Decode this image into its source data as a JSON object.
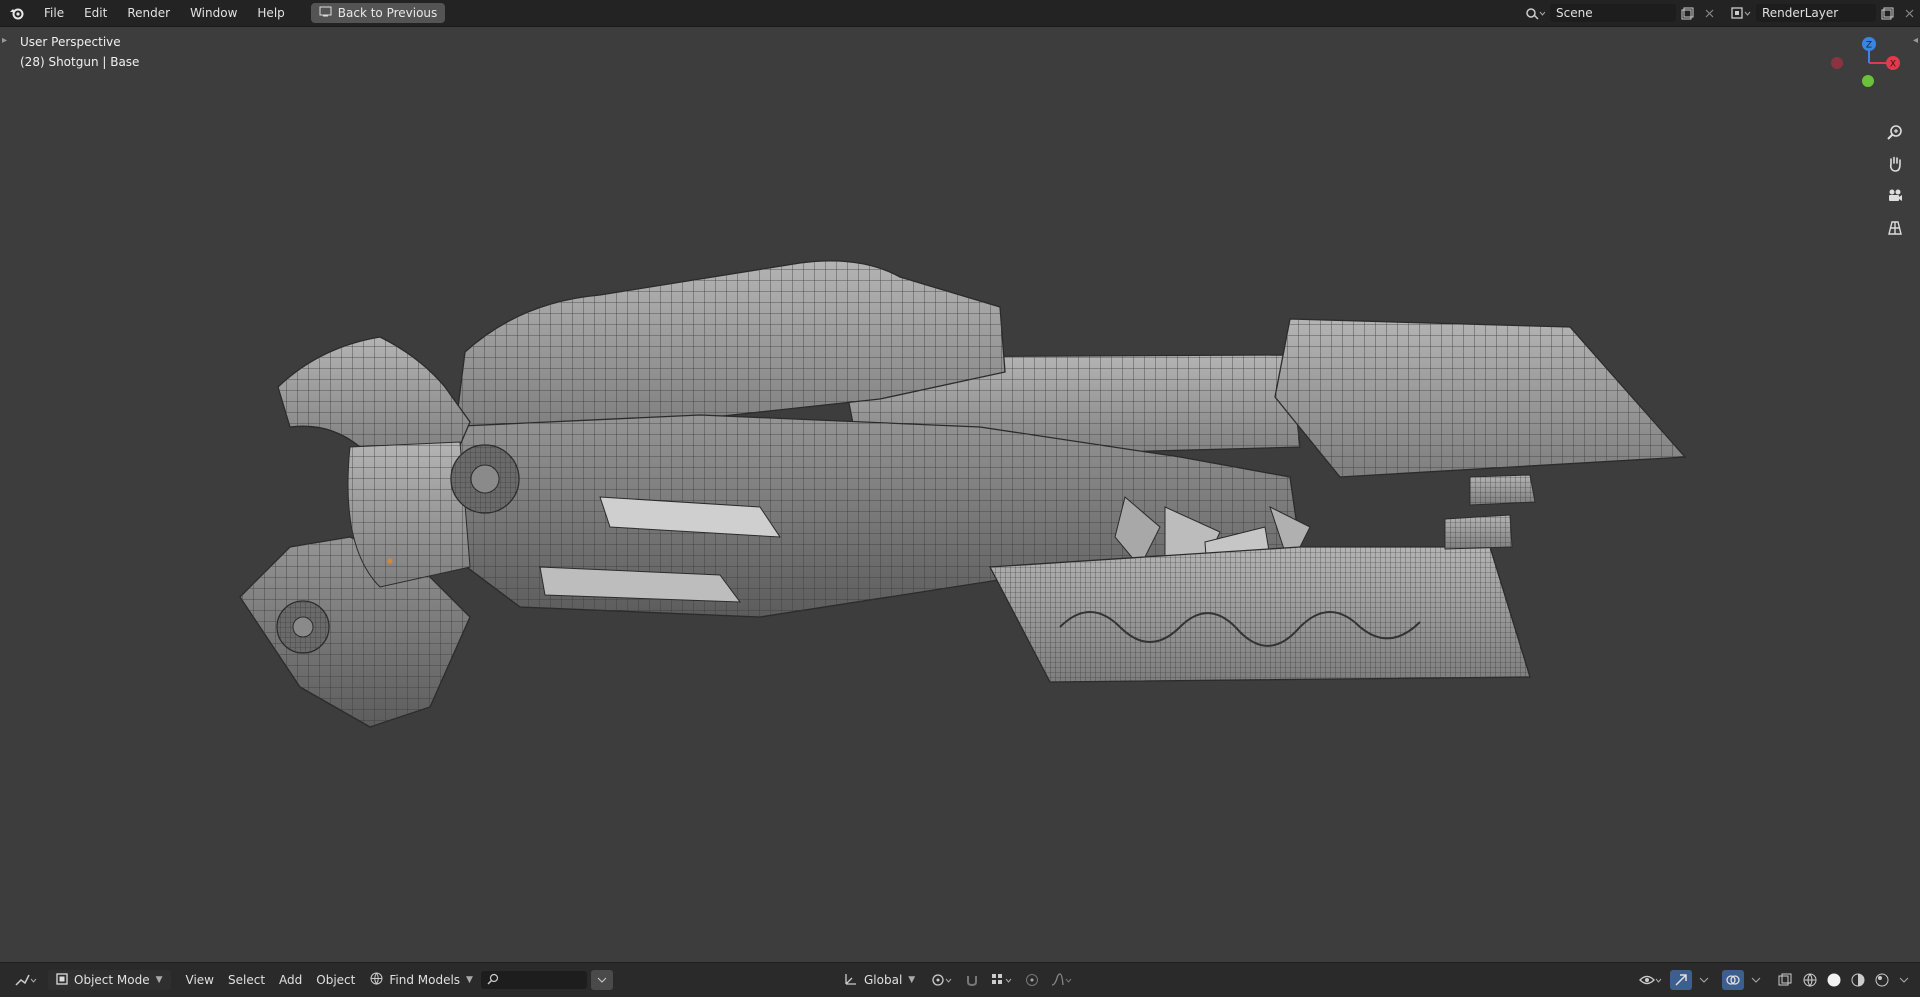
{
  "menu": {
    "items": [
      "File",
      "Edit",
      "Render",
      "Window",
      "Help"
    ],
    "back_button": "Back to Previous"
  },
  "scene": {
    "name": "Scene"
  },
  "render_layer": {
    "name": "RenderLayer"
  },
  "viewport": {
    "perspective_label": "User Perspective",
    "object_info": "(28) Shotgun | Base",
    "gizmo_axes": {
      "z": "Z",
      "x": "X"
    }
  },
  "toolbar": {
    "mode": "Object Mode",
    "view": "View",
    "select": "Select",
    "add": "Add",
    "object": "Object",
    "find_models": "Find Models",
    "search_placeholder": "",
    "transform_orientation": "Global"
  },
  "colors": {
    "topbar": "#232323",
    "viewport": "#3d3d3d",
    "axis_x": "#e23a4d",
    "axis_y": "#6bc23a",
    "axis_z": "#3a84e2",
    "active_shading": "#f2f2f2"
  },
  "icons": {
    "logo": "blender-logo-icon",
    "zoom": "zoom-icon",
    "pan": "hand-pan-icon",
    "camera": "camera-icon",
    "ortho": "grid-ortho-icon"
  }
}
